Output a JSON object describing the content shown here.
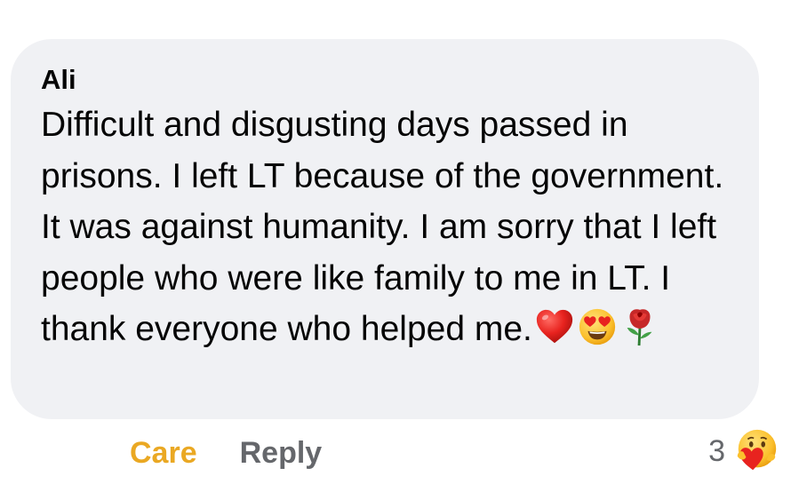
{
  "comment": {
    "author": "Ali",
    "text": "Difficult and disgusting days passed in prisons. I left LT because of the government. It was against humanity. I am sorry that I left people who were like family to me in LT. I thank everyone who helped me.",
    "emojis": [
      "red-heart-emoji",
      "heart-eyes-emoji",
      "rose-emoji"
    ],
    "bubble_color": "#f0f1f4"
  },
  "actions": {
    "care_label": "Care",
    "care_color": "#eaa823",
    "reply_label": "Reply",
    "reply_color": "#65676b"
  },
  "reactions": {
    "count": "3",
    "icon": "care-reaction-icon"
  }
}
